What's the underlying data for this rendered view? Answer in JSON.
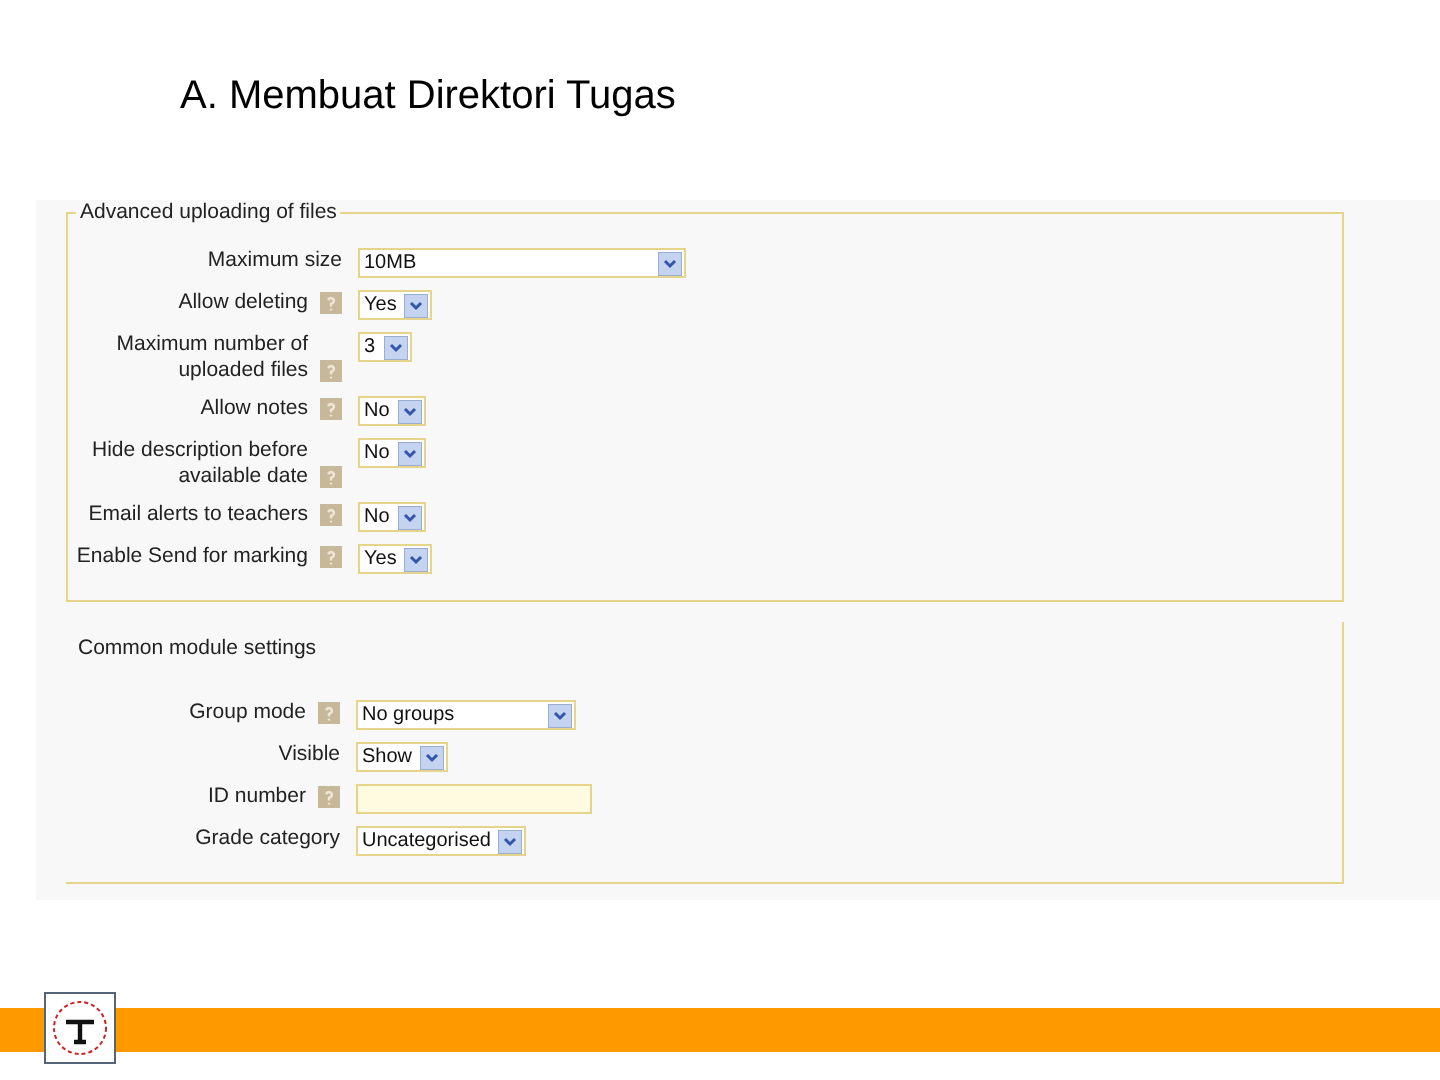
{
  "slide_title": "A. Membuat Direktori Tugas",
  "form": {
    "sections": [
      {
        "kind": "titled",
        "legend": "Advanced uploading of files",
        "fields": [
          {
            "label": "Maximum size",
            "help": false,
            "kind": "long_select",
            "value": "10MB"
          },
          {
            "label": "Allow deleting",
            "help": true,
            "kind": "select",
            "value": "Yes"
          },
          {
            "label": "Maximum number of uploaded files",
            "help": true,
            "kind": "select",
            "value": "3"
          },
          {
            "label": "Allow notes",
            "help": true,
            "kind": "select",
            "value": "No"
          },
          {
            "label": "Hide description before available date",
            "help": true,
            "kind": "select",
            "value": "No"
          },
          {
            "label": "Email alerts to teachers",
            "help": true,
            "kind": "select",
            "value": "No"
          },
          {
            "label": "Enable Send for marking",
            "help": true,
            "kind": "select",
            "value": "Yes"
          }
        ]
      },
      {
        "kind": "plain",
        "legend": "Common module settings",
        "fields": [
          {
            "label": "Group mode",
            "help": true,
            "kind": "medium_select",
            "value": "No groups"
          },
          {
            "label": "Visible",
            "help": false,
            "kind": "select",
            "value": "Show"
          },
          {
            "label": "ID number",
            "help": true,
            "kind": "text"
          },
          {
            "label": "Grade category",
            "help": false,
            "kind": "select",
            "value": "Uncategorised"
          }
        ]
      }
    ]
  }
}
